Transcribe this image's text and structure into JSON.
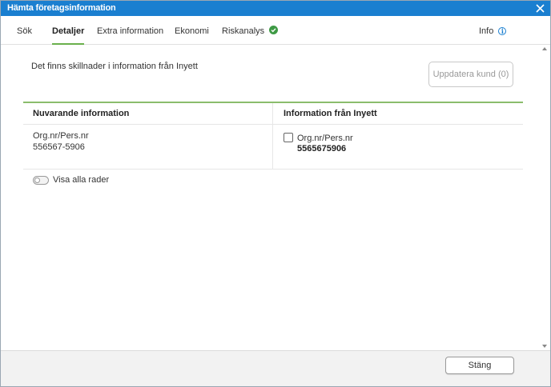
{
  "window": {
    "title": "Hämta företagsinformation"
  },
  "tabs": [
    {
      "label": "Sök"
    },
    {
      "label": "Detaljer",
      "active": true
    },
    {
      "label": "Extra information"
    },
    {
      "label": "Ekonomi"
    },
    {
      "label": "Riskanalys",
      "status_icon": "check-circle-icon"
    }
  ],
  "info_tab": {
    "label": "Info",
    "icon": "info-icon"
  },
  "main": {
    "message": "Det finns skillnader i information från Inyett",
    "update_button": "Uppdatera kund (0)",
    "columns": {
      "current": "Nuvarande information",
      "inyett": "Information från Inyett"
    },
    "rows": [
      {
        "label": "Org.nr/Pers.nr",
        "current_value": "556567-5906",
        "inyett_label": "Org.nr/Pers.nr",
        "inyett_value": "5565675906",
        "checked": false
      }
    ],
    "show_all_toggle": "Visa alla rader"
  },
  "footer": {
    "close_button": "Stäng"
  },
  "colors": {
    "titlebar": "#1a7fd0",
    "accent_green": "#6ab04c",
    "check_green": "#3e9a45"
  }
}
